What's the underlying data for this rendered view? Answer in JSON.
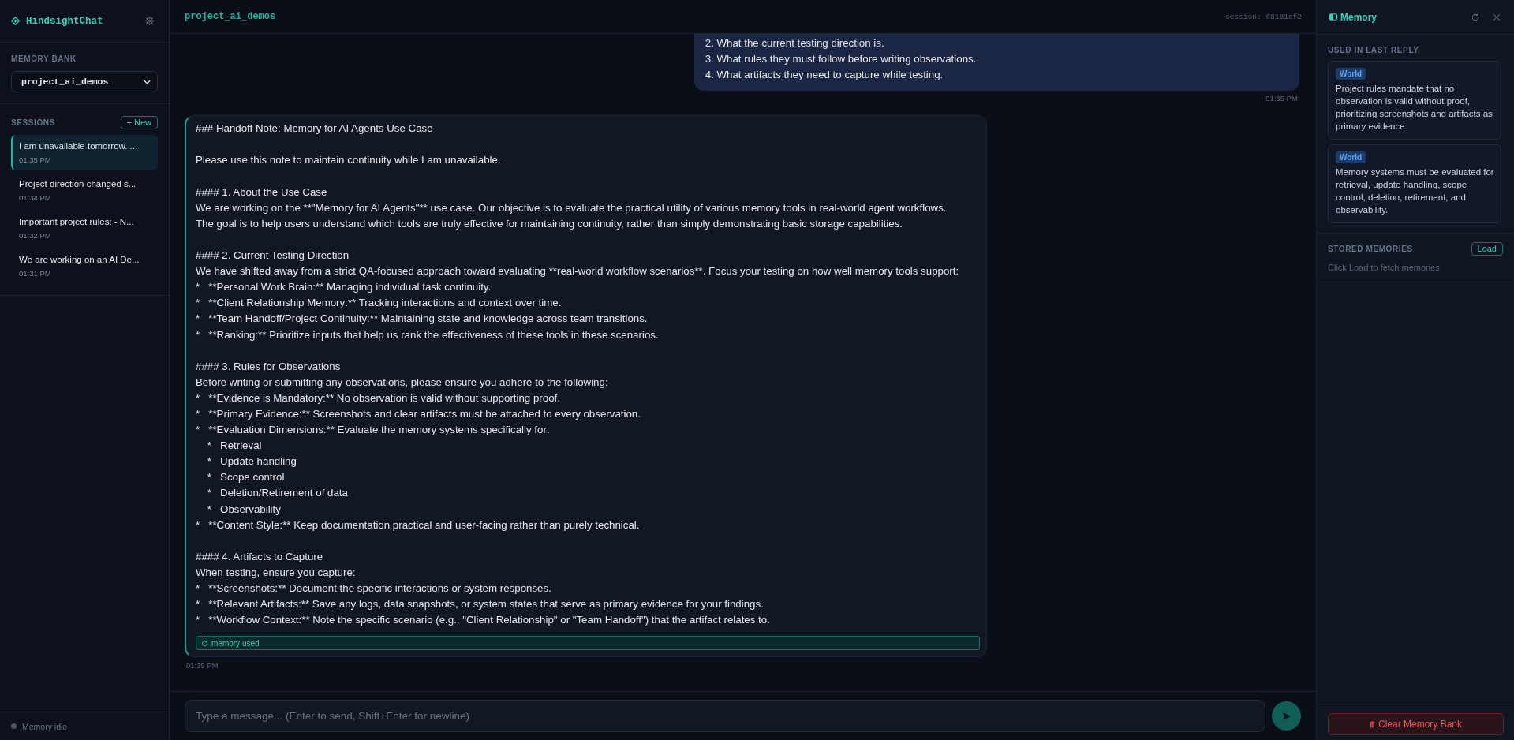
{
  "sidebar": {
    "logo": "HindsightChat",
    "memory_bank": {
      "label": "MEMORY BANK",
      "value": "project_ai_demos"
    },
    "sessions": {
      "label": "SESSIONS",
      "new_button": "+ New",
      "items": [
        {
          "title": "I am unavailable tomorrow. ...",
          "time": "01:35 PM",
          "selected": true
        },
        {
          "title": "Project direction changed s...",
          "time": "01:34 PM",
          "selected": false
        },
        {
          "title": "Important project rules: - N...",
          "time": "01:32 PM",
          "selected": false
        },
        {
          "title": "We are working on an AI De...",
          "time": "01:31 PM",
          "selected": false
        }
      ]
    },
    "status": "Memory idle"
  },
  "header": {
    "title": "project_ai_demos",
    "session": "session: 68181ef2"
  },
  "messages": [
    {
      "kind": "user",
      "groups": [
        [
          "2. What the current testing direction is.",
          "3. What rules they must follow before writing observations.",
          "4. What artifacts they need to capture while testing."
        ]
      ],
      "time": "01:35 PM"
    },
    {
      "kind": "assistant",
      "groups": [
        [
          "### Handoff Note: Memory for AI Agents Use Case"
        ],
        [
          "Please use this note to maintain continuity while I am unavailable."
        ],
        [
          "#### 1. About the Use Case",
          "We are working on the **\"Memory for AI Agents\"** use case. Our objective is to evaluate the practical utility of various memory tools in real-world agent workflows.",
          "The goal is to help users understand which tools are truly effective for maintaining continuity, rather than simply demonstrating basic storage capabilities."
        ],
        [
          "#### 2. Current Testing Direction",
          "We have shifted away from a strict QA-focused approach toward evaluating **real-world workflow scenarios**. Focus your testing on how well memory tools support:",
          "*   **Personal Work Brain:** Managing individual task continuity.",
          "*   **Client Relationship Memory:** Tracking interactions and context over time.",
          "*   **Team Handoff/Project Continuity:** Maintaining state and knowledge across team transitions.",
          "*   **Ranking:** Prioritize inputs that help us rank the effectiveness of these tools in these scenarios."
        ],
        [
          "#### 3. Rules for Observations",
          "Before writing or submitting any observations, please ensure you adhere to the following:",
          "*   **Evidence is Mandatory:** No observation is valid without supporting proof.",
          "*   **Primary Evidence:** Screenshots and clear artifacts must be attached to every observation.",
          "*   **Evaluation Dimensions:** Evaluate the memory systems specifically for:",
          "    *   Retrieval",
          "    *   Update handling",
          "    *   Scope control",
          "    *   Deletion/Retirement of data",
          "    *   Observability",
          "*   **Content Style:** Keep documentation practical and user-facing rather than purely technical."
        ],
        [
          "#### 4. Artifacts to Capture",
          "When testing, ensure you capture:",
          "*   **Screenshots:** Document the specific interactions or system responses.",
          "*   **Relevant Artifacts:** Save any logs, data snapshots, or system states that serve as primary evidence for your findings.",
          "*   **Workflow Context:** Note the specific scenario (e.g., \"Client Relationship\" or \"Team Handoff\") that the artifact relates to."
        ]
      ],
      "badge": "memory used",
      "time": "01:35 PM"
    }
  ],
  "composer": {
    "placeholder": "Type a message... (Enter to send, Shift+Enter for newline)"
  },
  "memory_panel": {
    "title": "Memory",
    "used": {
      "label": "USED IN LAST REPLY",
      "items": [
        {
          "type": "World",
          "text": "Project rules mandate that no observation is valid without proof, prioritizing screenshots and artifacts as primary evidence."
        },
        {
          "type": "World",
          "text": "Memory systems must be evaluated for retrieval, update handling, scope control, deletion, retirement, and observability."
        }
      ]
    },
    "stored": {
      "label": "STORED MEMORIES",
      "button": "Load",
      "hint": "Click Load to fetch memories"
    },
    "clear_button": "Clear Memory Bank"
  }
}
